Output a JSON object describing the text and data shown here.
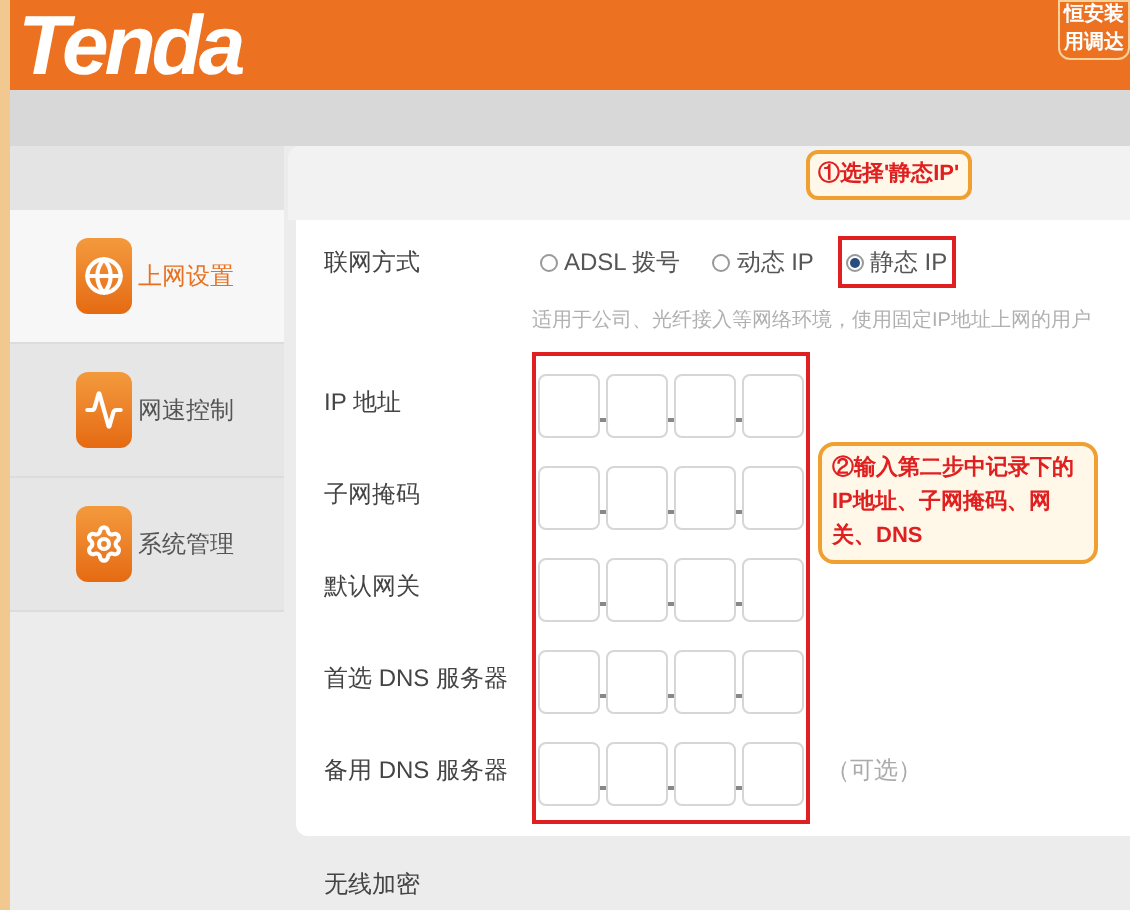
{
  "header": {
    "logo": "Tenda",
    "corner_lines": [
      "恒安装",
      "用调达"
    ]
  },
  "sidebar": {
    "items": [
      {
        "label": "上网设置",
        "kind": "browser",
        "selected": true
      },
      {
        "label": "网速控制",
        "kind": "speed",
        "selected": false
      },
      {
        "label": "系统管理",
        "kind": "system",
        "selected": false
      }
    ]
  },
  "form": {
    "mode_label": "联网方式",
    "modes": [
      {
        "label": "ADSL 拨号",
        "selected": false
      },
      {
        "label": "动态 IP",
        "selected": false
      },
      {
        "label": "静态 IP",
        "selected": true
      }
    ],
    "hint": "适用于公司、光纤接入等网络环境，使用固定IP地址上网的用户",
    "fields": [
      {
        "label": "IP 地址"
      },
      {
        "label": "子网掩码"
      },
      {
        "label": "默认网关"
      },
      {
        "label": "首选 DNS 服务器"
      },
      {
        "label": "备用 DNS 服务器",
        "note": "（可选）"
      }
    ]
  },
  "next_section": "无线加密",
  "annotations": [
    {
      "text": "①选择'静态IP'"
    },
    {
      "text": "②输入第二步中记录下的IP地址、子网掩码、网关、DNS"
    }
  ]
}
